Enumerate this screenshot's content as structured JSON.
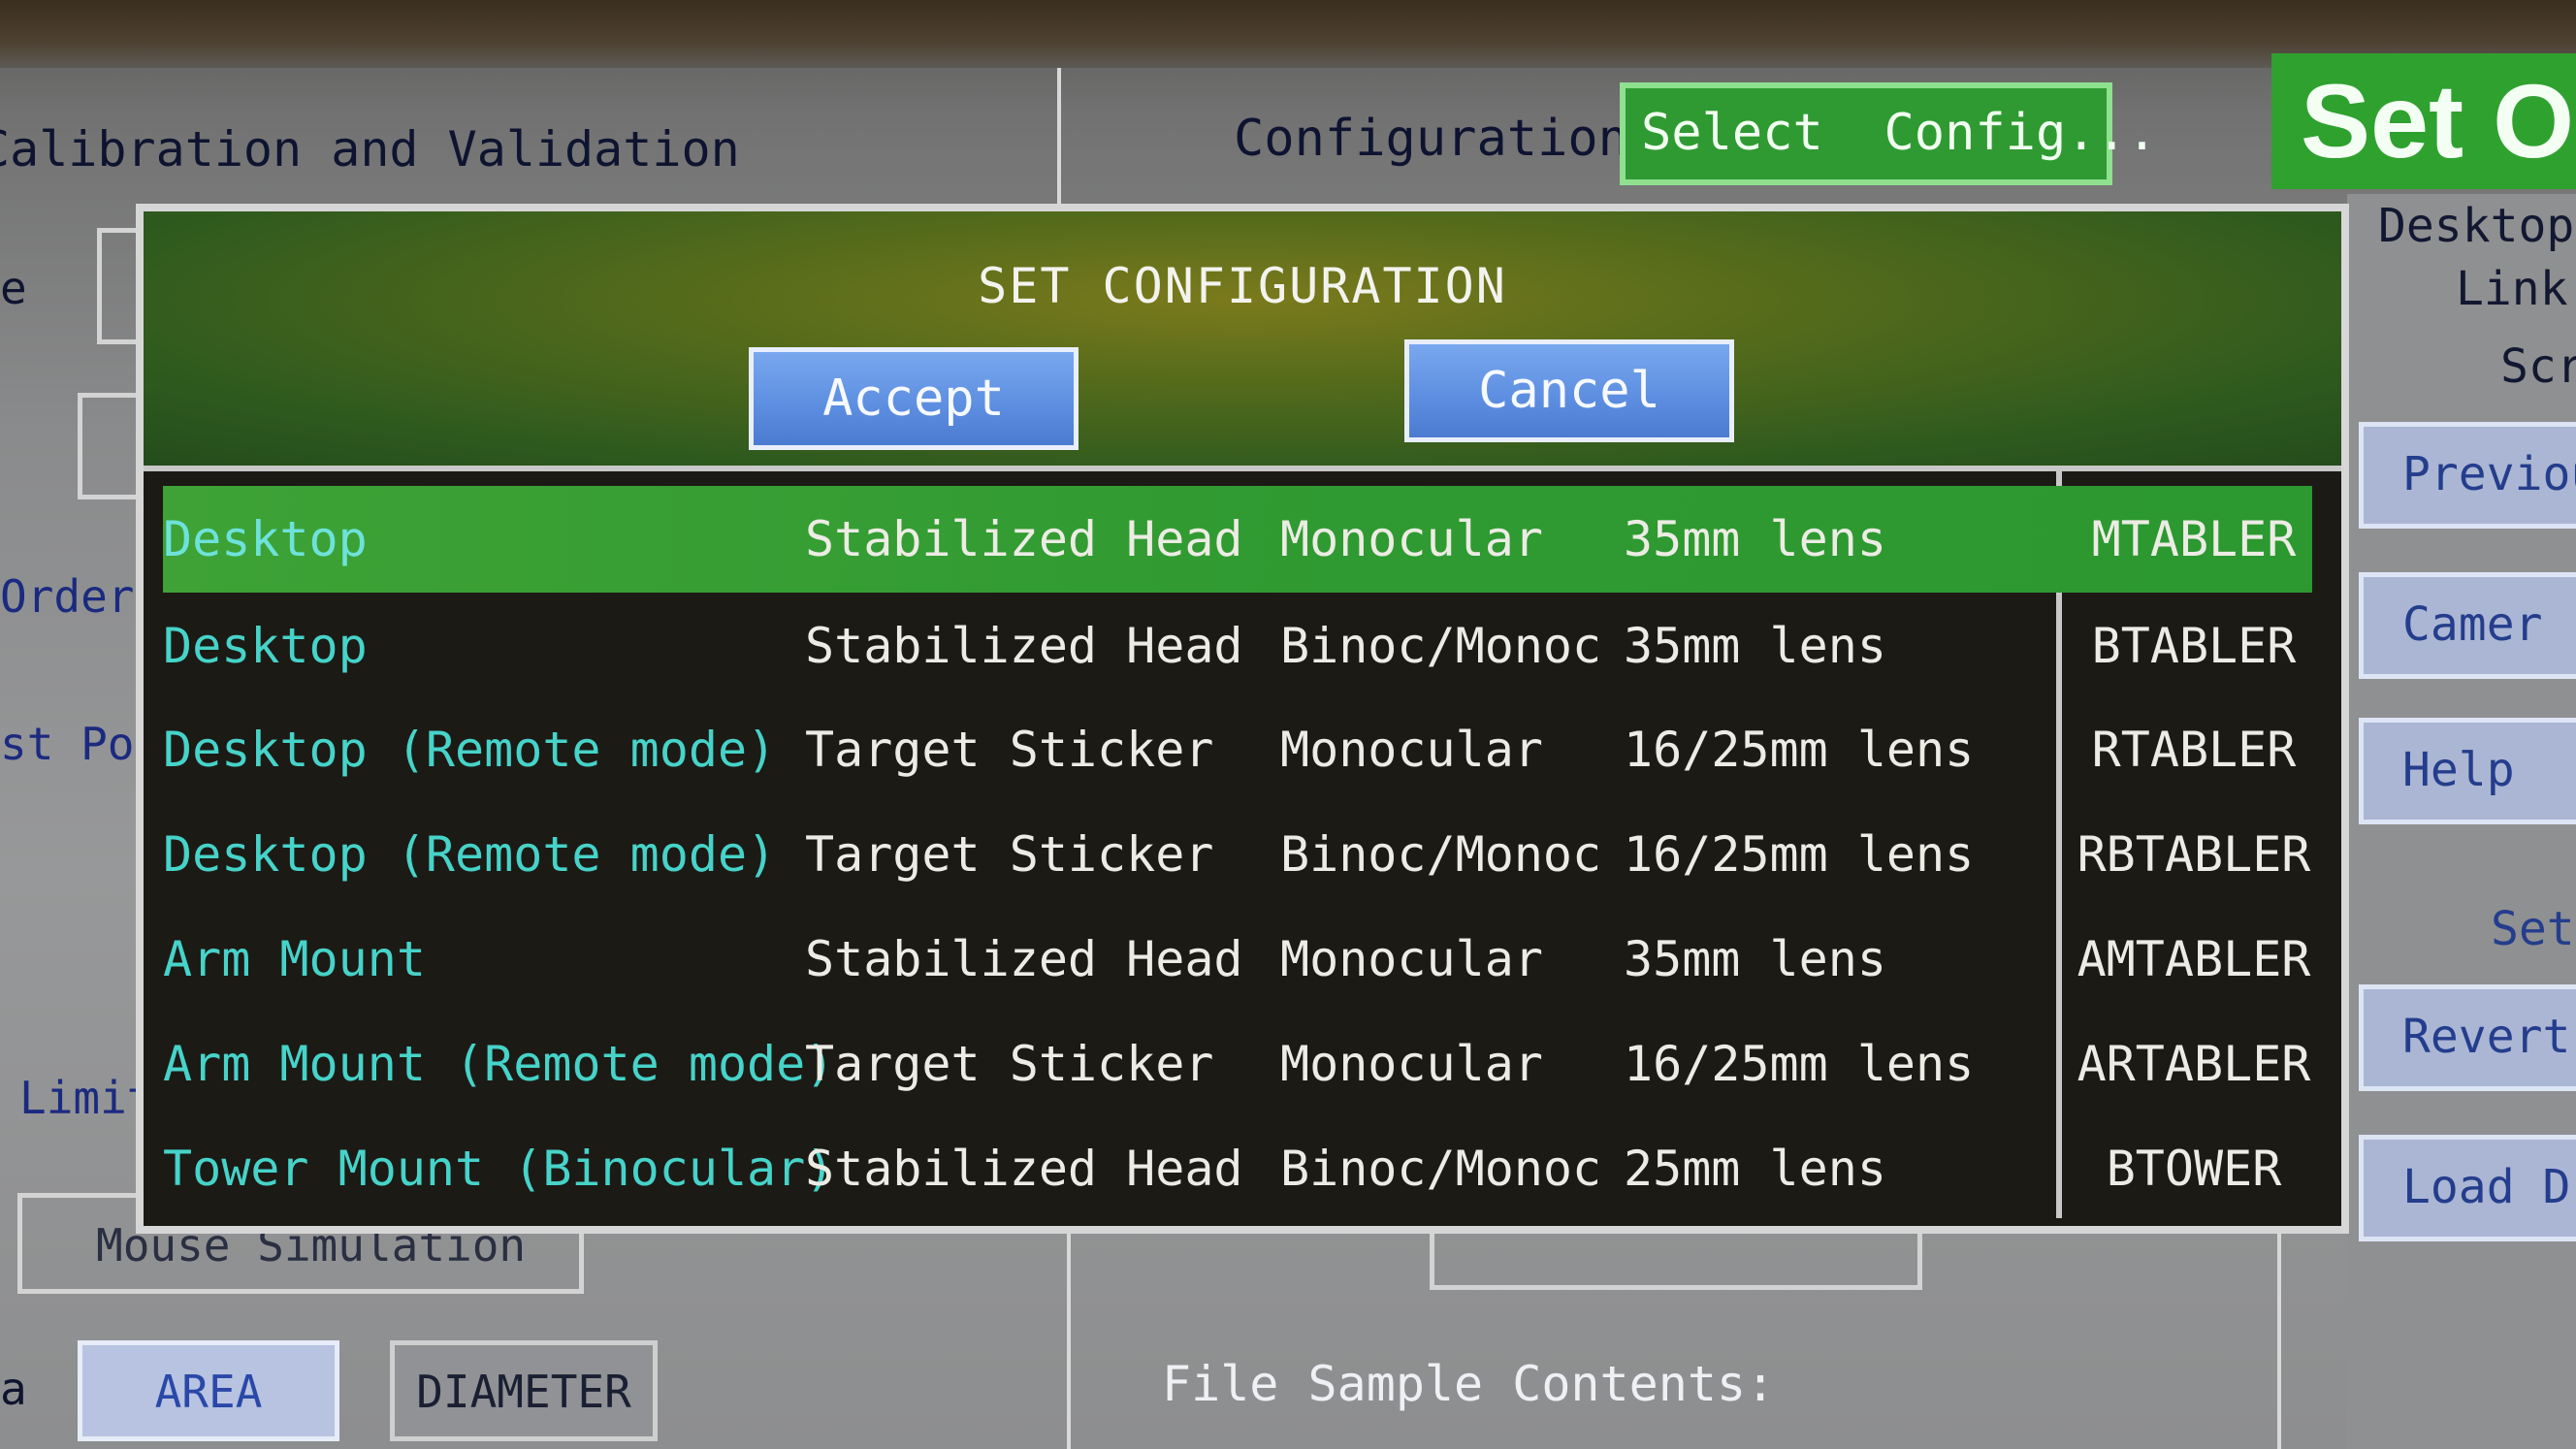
{
  "background": {
    "title": "Calibration and Validation",
    "configuration_label": "Configuration:",
    "configuration_value": "Select  Config...",
    "set_options_title": "Set Op",
    "side_labels": [
      "Desktop",
      "Link",
      "Scr"
    ],
    "side_buttons": [
      "Previou",
      "Camer",
      "Help",
      "Set",
      "Revert",
      "Load D"
    ],
    "left_fragments": [
      "e",
      "Order",
      "st Poi",
      "Limit",
      "Mouse Simulation",
      "a"
    ],
    "bottom_buttons": {
      "area": "AREA",
      "diameter": "DIAMETER"
    },
    "file_sample_label": "File Sample Contents:"
  },
  "dialog": {
    "title": "SET CONFIGURATION",
    "accept_label": "Accept",
    "cancel_label": "Cancel",
    "selected_index": 0,
    "rows": [
      {
        "name": "Desktop",
        "head": "Stabilized Head",
        "ocular": "Monocular",
        "lens": "35mm lens",
        "code": "MTABLER"
      },
      {
        "name": "Desktop",
        "head": "Stabilized Head",
        "ocular": "Binoc/Monoc",
        "lens": "35mm lens",
        "code": "BTABLER"
      },
      {
        "name": "Desktop (Remote mode)",
        "head": "Target Sticker",
        "ocular": "Monocular",
        "lens": "16/25mm lens",
        "code": "RTABLER"
      },
      {
        "name": "Desktop (Remote mode)",
        "head": "Target Sticker",
        "ocular": "Binoc/Monoc",
        "lens": "16/25mm lens",
        "code": "RBTABLER"
      },
      {
        "name": "Arm Mount",
        "head": "Stabilized Head",
        "ocular": "Monocular",
        "lens": "35mm lens",
        "code": "AMTABLER"
      },
      {
        "name": "Arm Mount (Remote mode)",
        "head": "Target Sticker",
        "ocular": "Monocular",
        "lens": "16/25mm lens",
        "code": "ARTABLER"
      },
      {
        "name": "Tower Mount (Binocular)",
        "head": "Stabilized Head",
        "ocular": "Binoc/Monoc",
        "lens": "25mm lens",
        "code": "BTOWER"
      }
    ]
  },
  "colors": {
    "selected_row": "#2f9a31",
    "accent_green": "#2fa12f",
    "button_blue": "#5c8de0",
    "name_cyan": "#46d3c9"
  }
}
